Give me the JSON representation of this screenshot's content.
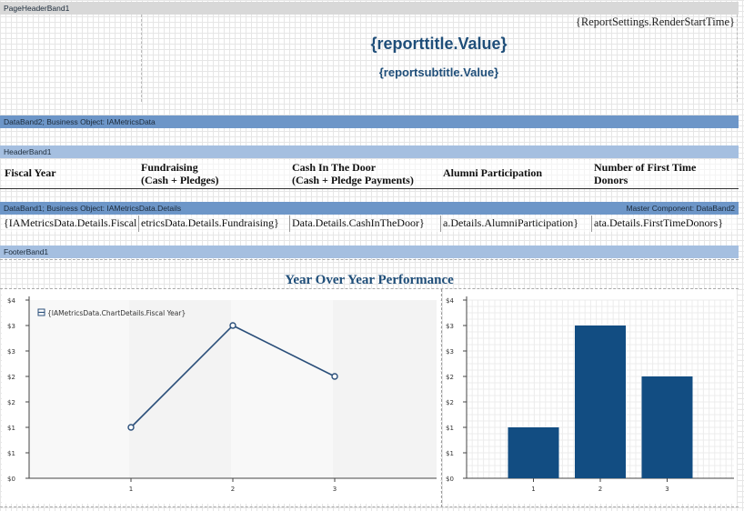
{
  "bands": {
    "page_header": "PageHeaderBand1",
    "data_band2": "DataBand2;  Business  Object:  IAMetricsData",
    "header_band": "HeaderBand1",
    "data_band1": "DataBand1;  Business  Object:  IAMetricsData.Details",
    "data_band1_master": "Master Component: DataBand2",
    "footer_band": "FooterBand1"
  },
  "header": {
    "render_time": "{ReportSettings.RenderStartTime}",
    "title": "{reporttitle.Value}",
    "subtitle": "{reportsubtitle.Value}"
  },
  "columns": {
    "fiscal_year": "Fiscal Year",
    "fundraising_1": "Fundraising",
    "fundraising_2": "(Cash + Pledges)",
    "cash_1": "Cash In The Door",
    "cash_2": "(Cash + Pledge Payments)",
    "alumni": "Alumni Participation",
    "donors_1": "Number of First Time",
    "donors_2": "Donors"
  },
  "data_row": {
    "fiscal_year": "{IAMetricsData.Details.Fiscal",
    "fundraising": "etricsData.Details.Fundraising}",
    "cash": "Data.Details.CashInTheDoor}",
    "alumni": "a.Details.AlumniParticipation}",
    "donors": "ata.Details.FirstTimeDonors}"
  },
  "footer": {
    "chart_title": "Year Over Year Performance"
  },
  "chart_data": [
    {
      "type": "line",
      "legend": "{IAMetricsData.ChartDetails.Fiscal Year}",
      "legend_placement": "top-left",
      "x": [
        1,
        2,
        3
      ],
      "y": [
        1,
        3,
        2
      ],
      "y_ticks": [
        "$0",
        "$1",
        "$1",
        "$2",
        "$2",
        "$3",
        "$3",
        "$4"
      ],
      "x_ticks": [
        "1",
        "2",
        "3"
      ],
      "ylim": [
        0,
        3.5
      ],
      "grid": false,
      "color": "#2b4f7a"
    },
    {
      "type": "bar",
      "categories": [
        "1",
        "2",
        "3"
      ],
      "values": [
        1,
        3,
        2
      ],
      "y_ticks": [
        "$0",
        "$1",
        "$1",
        "$2",
        "$2",
        "$3",
        "$3",
        "$4"
      ],
      "ylim": [
        0,
        3.5
      ],
      "grid": true,
      "color": "#124d82"
    }
  ]
}
